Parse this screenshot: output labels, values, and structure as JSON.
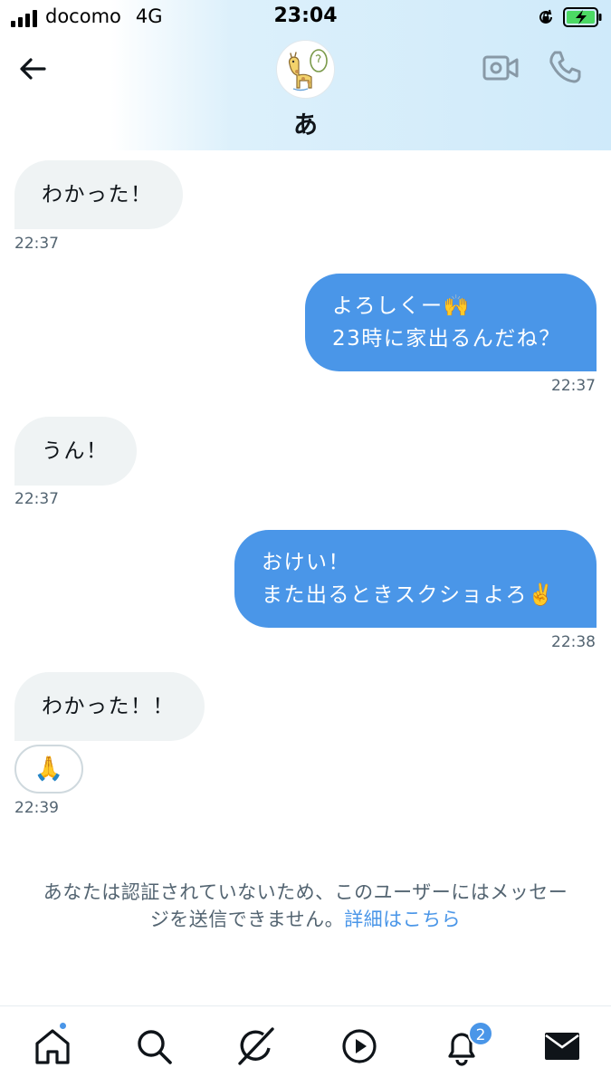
{
  "status_bar": {
    "carrier": "docomo",
    "network": "4G",
    "time": "23:04"
  },
  "conversation": {
    "contact_name": "あ",
    "avatar_icon": "giraffe-avatar-icon",
    "header_actions": [
      "video-call-icon",
      "phone-call-icon"
    ]
  },
  "messages": [
    {
      "direction": "in",
      "lines": [
        "わかった！"
      ],
      "time": "22:37"
    },
    {
      "direction": "out",
      "lines": [
        "よろしくー🙌",
        "23時に家出るんだね？"
      ],
      "time": "22:37"
    },
    {
      "direction": "in",
      "lines": [
        "うん！"
      ],
      "time": "22:37"
    },
    {
      "direction": "out",
      "lines": [
        "おけい！",
        "また出るときスクショよろ✌️"
      ],
      "time": "22:38"
    },
    {
      "direction": "in",
      "lines": [
        "わかった！！"
      ],
      "reaction": "🙏",
      "time": "22:39"
    }
  ],
  "notice": {
    "text_line1": "あなたは認証されていないため、このユーザーにはメッセー",
    "text_line2": "ジを送信できません。",
    "link": "詳細はこちら"
  },
  "tabbar": {
    "items": [
      "home-icon",
      "search-icon",
      "grok-icon",
      "video-icon",
      "notifications-icon",
      "messages-icon"
    ],
    "home_has_dot": true,
    "notifications_count": "2"
  },
  "colors": {
    "accent": "#4a96e8",
    "incoming_bubble": "#eff3f4",
    "secondary_text": "#536471"
  }
}
